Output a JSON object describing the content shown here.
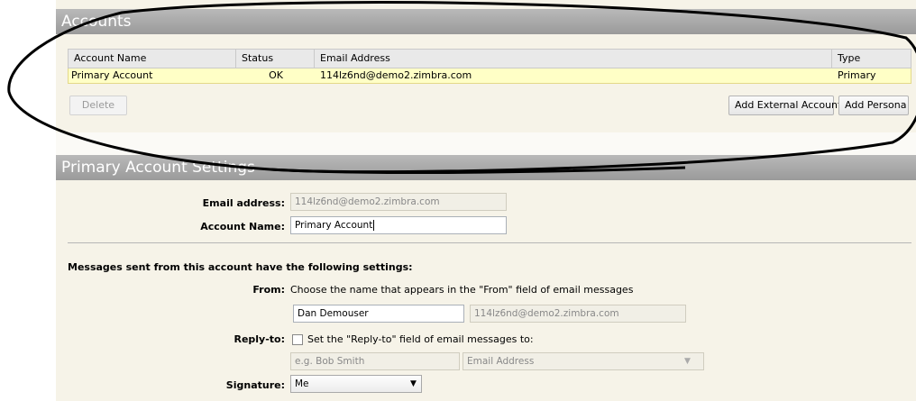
{
  "accounts": {
    "title": "Accounts",
    "columns": {
      "name": "Account Name",
      "status": "Status",
      "email": "Email Address",
      "type": "Type"
    },
    "rows": [
      {
        "name": "Primary Account",
        "status": "OK",
        "email": "114lz6nd@demo2.zimbra.com",
        "type": "Primary"
      }
    ],
    "delete_label": "Delete",
    "add_external_label": "Add External Account",
    "add_persona_label": "Add Persona"
  },
  "settings": {
    "title": "Primary Account Settings",
    "email_label": "Email address:",
    "email_value": "114lz6nd@demo2.zimbra.com",
    "account_name_label": "Account Name:",
    "account_name_value": "Primary Account",
    "messages_heading": "Messages sent from this account have the following settings:",
    "from_label": "From:",
    "from_hint": "Choose the name that appears in the \"From\" field of email messages",
    "from_name_value": "Dan Demouser",
    "from_email_value": "114lz6nd@demo2.zimbra.com",
    "replyto_label": "Reply-to:",
    "replyto_checkbox_label": "Set the \"Reply-to\" field of email messages to:",
    "replyto_name_placeholder": "e.g. Bob Smith",
    "replyto_email_placeholder": "Email Address",
    "signature_label": "Signature:",
    "signature_value": "Me"
  },
  "annotation": {
    "color": "#000000"
  }
}
